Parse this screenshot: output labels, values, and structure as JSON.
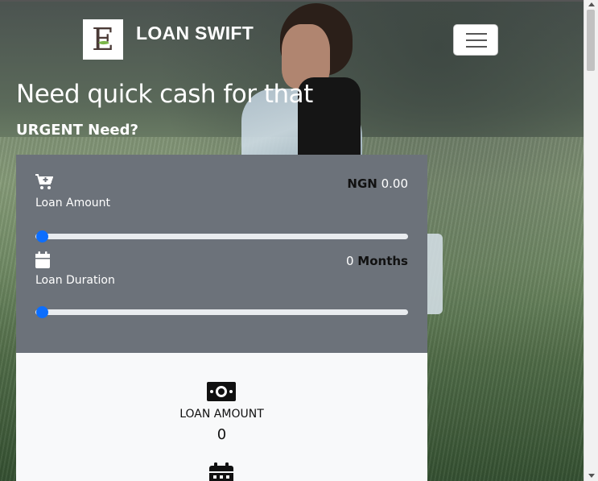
{
  "brand": {
    "name": "LOAN SWIFT",
    "logo_letter": "E"
  },
  "nav": {
    "toggler_icon": "hamburger-icon"
  },
  "hero": {
    "title": "Need quick cash for that",
    "subtitle": "URGENT Need?"
  },
  "calculator": {
    "amount": {
      "icon": "cart-plus-icon",
      "label": "Loan Amount",
      "currency": "NGN",
      "value": "0.00",
      "slider_level": 0
    },
    "duration": {
      "icon": "calendar-icon",
      "label": "Loan Duration",
      "value": "0",
      "unit": "Months",
      "slider_level": 0
    }
  },
  "summary": {
    "loan_amount": {
      "icon": "money-bill-icon",
      "label": "LOAN AMOUNT",
      "value": "0"
    },
    "next_icon": "calendar-grid-icon"
  },
  "colors": {
    "card": "#6c727a",
    "lower": "#f8f9fa",
    "slider_thumb": "#0d6efd"
  }
}
